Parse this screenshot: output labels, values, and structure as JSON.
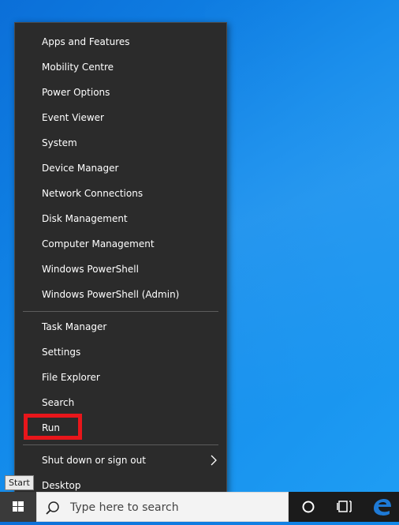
{
  "menu": {
    "items": [
      {
        "label": "Apps and Features"
      },
      {
        "label": "Mobility Centre"
      },
      {
        "label": "Power Options"
      },
      {
        "label": "Event Viewer"
      },
      {
        "label": "System"
      },
      {
        "label": "Device Manager"
      },
      {
        "label": "Network Connections"
      },
      {
        "label": "Disk Management"
      },
      {
        "label": "Computer Management"
      },
      {
        "label": "Windows PowerShell"
      },
      {
        "label": "Windows PowerShell (Admin)"
      },
      {
        "label": "Task Manager"
      },
      {
        "label": "Settings"
      },
      {
        "label": "File Explorer"
      },
      {
        "label": "Search"
      },
      {
        "label": "Run"
      },
      {
        "label": "Shut down or sign out"
      },
      {
        "label": "Desktop"
      }
    ]
  },
  "tooltip": {
    "start": "Start"
  },
  "taskbar": {
    "search_placeholder": "Type here to search",
    "icons": [
      "windows-logo-icon",
      "search-icon",
      "cortana-icon",
      "task-view-icon",
      "edge-icon"
    ]
  },
  "colors": {
    "menu_bg": "#2b2b2b",
    "highlight": "#e8161b",
    "desktop": "#1289ea",
    "taskbar": "#1b1b1b",
    "edge_blue": "#1e7ad6"
  }
}
